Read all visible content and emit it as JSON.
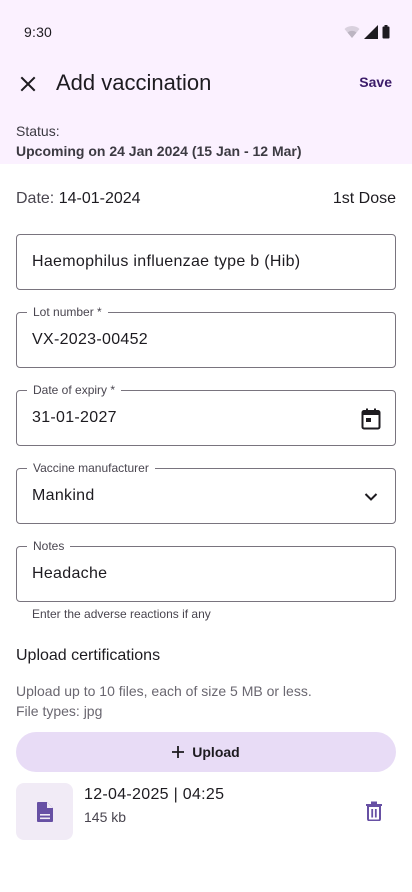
{
  "status_bar": {
    "time": "9:30",
    "icons": [
      "wifi-icon",
      "signal-icon",
      "battery-icon"
    ]
  },
  "app_bar": {
    "close_icon": "close-icon",
    "title": "Add vaccination",
    "save_label": "Save"
  },
  "status": {
    "label": "Status:",
    "value": "Upcoming on 24 Jan 2024 (15 Jan - 12 Mar)"
  },
  "date_row": {
    "label": "Date:",
    "value": "14-01-2024",
    "dose": "1st Dose"
  },
  "fields": {
    "vaccine_name": {
      "value": "Haemophilus influenzae type b (Hib)"
    },
    "lot_number": {
      "label": "Lot number *",
      "value": "VX-2023-00452"
    },
    "expiry": {
      "label": "Date of expiry *",
      "value": "31-01-2027",
      "icon": "calendar-icon"
    },
    "manufacturer": {
      "label": "Vaccine manufacturer",
      "value": "Mankind",
      "icon": "chevron-down-icon"
    },
    "notes": {
      "label": "Notes",
      "value": "Headache",
      "helper": "Enter the adverse reactions if any"
    }
  },
  "upload": {
    "heading": "Upload certifications",
    "info_line1": "Upload up to 10 files, each of size 5 MB or less.",
    "info_line2": "File types: jpg",
    "button_label": "Upload",
    "files": [
      {
        "name": "12-04-2025 | 04:25",
        "size": "145 kb"
      }
    ]
  },
  "colors": {
    "header_bg": "#fbf1ff",
    "accent": "#3b1b69",
    "button_tonal": "#e8dcf6",
    "icon_purple": "#6750a4"
  }
}
